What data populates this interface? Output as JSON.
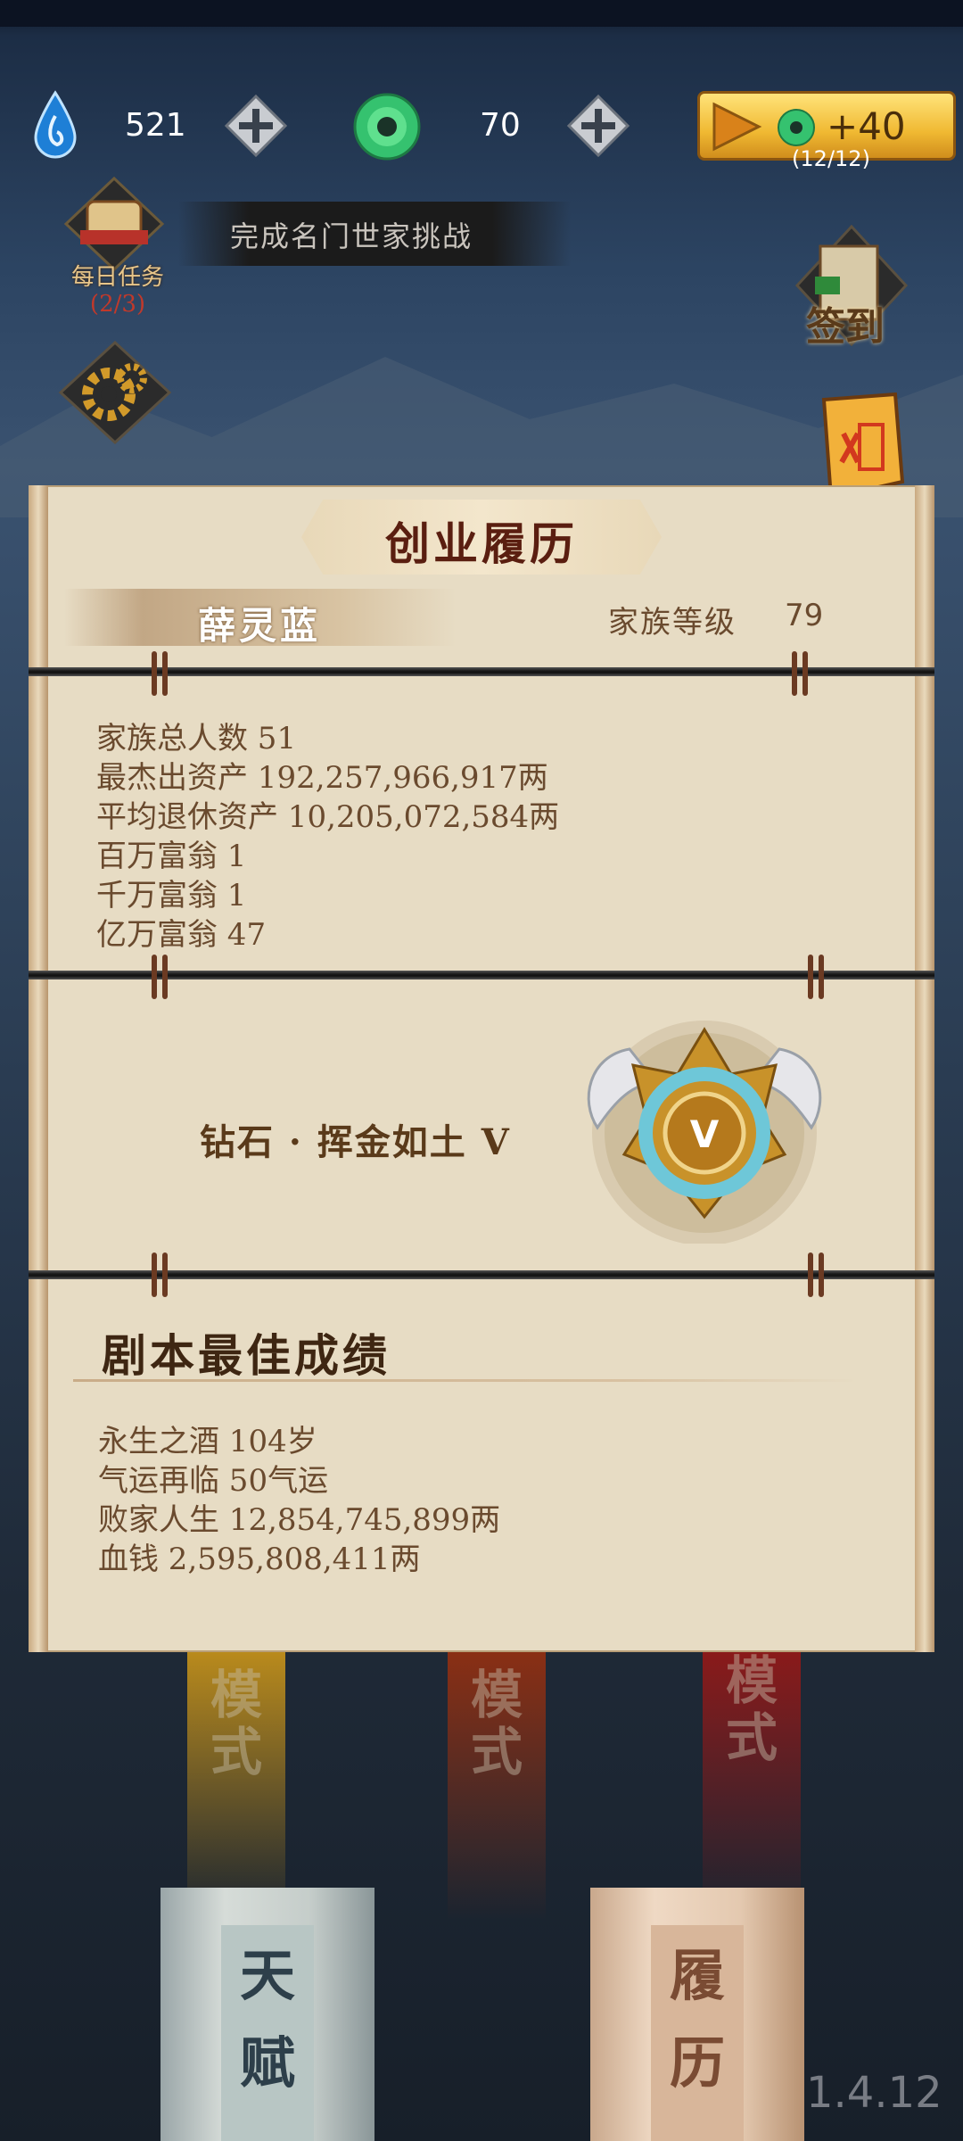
{
  "resources": {
    "energy": {
      "icon": "water-drop-icon",
      "value": "521"
    },
    "jade": {
      "icon": "jade-coin-icon",
      "value": "70"
    },
    "watch_ad": {
      "label": "+40",
      "count": "(12/12)"
    }
  },
  "tasks": {
    "banner_text": "完成名门世家挑战",
    "daily_label": "每日任务",
    "daily_progress": "(2/3)",
    "signin_label": "签到"
  },
  "panel": {
    "title": "创业履历",
    "player_name": "薛灵蓝",
    "level_label": "家族等级",
    "level_value": "79",
    "stats": [
      "家族总人数 51",
      "最杰出资产 192,257,966,917两",
      "平均退休资产 10,205,072,584两",
      "百万富翁 1",
      "千万富翁 1",
      "亿万富翁 47"
    ],
    "rank": "钻石 · 挥金如土 V",
    "badge_letter": "V",
    "best_title": "剧本最佳成绩",
    "best_stats": [
      "永生之酒 104岁",
      "气运再临 50气运",
      "败家人生 12,854,745,899两",
      "血钱 2,595,808,411两"
    ]
  },
  "scene": {
    "banners": [
      {
        "chars": [
          "模",
          "式"
        ],
        "color": "#b98a1c"
      },
      {
        "chars": [
          "模",
          "式"
        ],
        "color": "#8a2f14"
      },
      {
        "chars": [
          "模",
          "式"
        ],
        "color": "#8a1a1a"
      }
    ],
    "cards": [
      {
        "chars": [
          "天",
          "赋"
        ],
        "color": "#2d3f4a"
      },
      {
        "chars": [
          "履",
          "历"
        ],
        "color": "#7a4b33"
      }
    ],
    "version": "1.4.12"
  },
  "colors": {
    "panel_bg": "#e7dcc4",
    "text_brown": "#6a4a2e",
    "title_red": "#5a1e10",
    "gold": "#f0b932"
  }
}
